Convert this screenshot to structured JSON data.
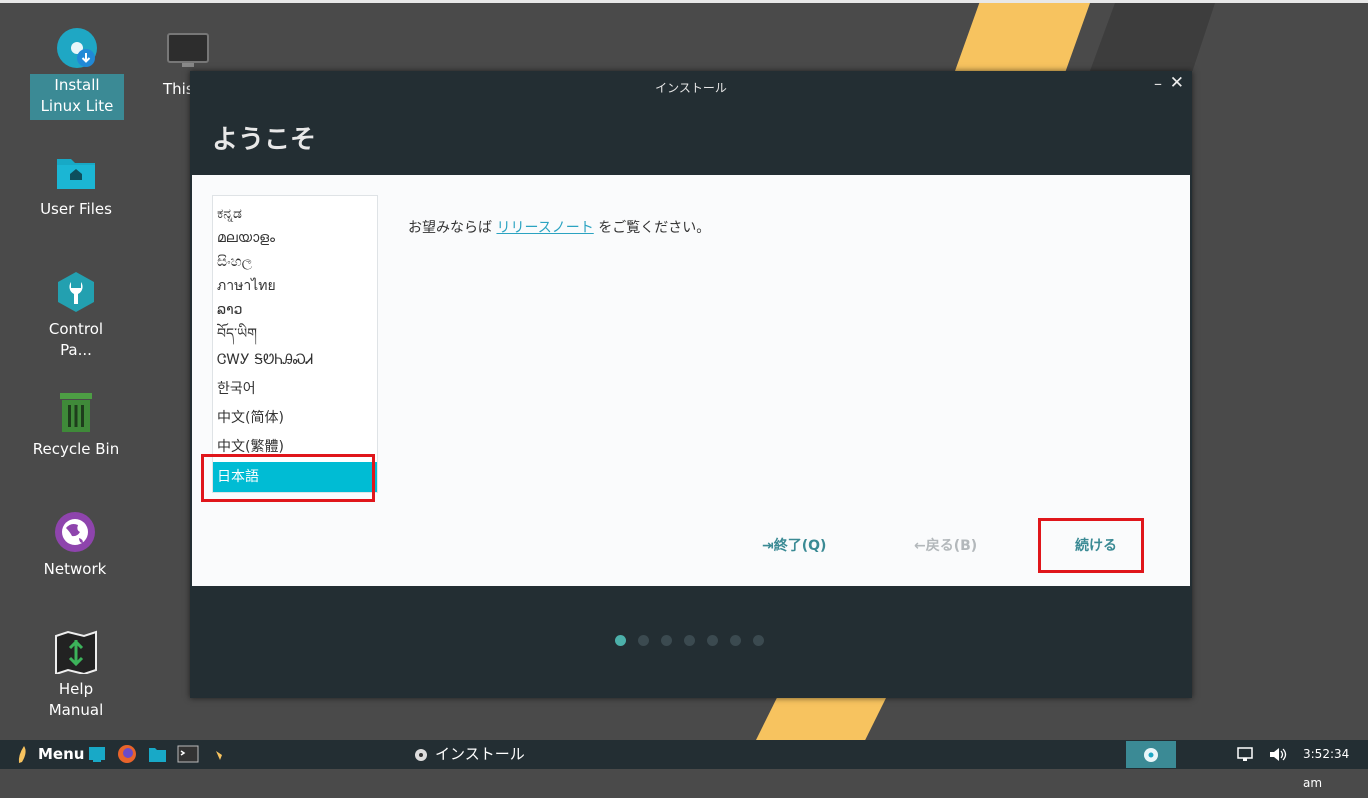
{
  "desktop": {
    "icons": [
      {
        "label": "Install Linux Lite"
      },
      {
        "label": "This"
      },
      {
        "label": "User Files"
      },
      {
        "label": "Control Pa..."
      },
      {
        "label": "Recycle Bin"
      },
      {
        "label": "Network"
      },
      {
        "label": "Help Manual"
      }
    ]
  },
  "window": {
    "title": "インストール",
    "heading": "ようこそ",
    "minimize": "–",
    "close": "✕",
    "languages": [
      "ಕನ್ನಡ",
      "മലയാളം",
      "සිංහල",
      "ภาษาไทย",
      "ລາວ",
      "བོད་ཡིག",
      "ᏣᎳᎩ ᎦᏬᏂᎯᏍᏗ",
      "한국어",
      "中文(简体)",
      "中文(繁體)",
      "日本語"
    ],
    "notes_before": "お望みならば",
    "notes_link": "リリースノート",
    "notes_after": "をご覧ください。",
    "quit_label": "終了(Q)",
    "back_label": "戻る(B)",
    "continue_label": "続ける",
    "quit_icon": "⇥",
    "back_icon": "←"
  },
  "taskbar": {
    "menu_label": "Menu",
    "task_label": "インストール",
    "clock": "3:52:34 am"
  },
  "colors": {
    "accent": "#00bcd4",
    "highlight": "#e0161b",
    "window_bg": "#232e33",
    "link": "#2ba3c1"
  }
}
